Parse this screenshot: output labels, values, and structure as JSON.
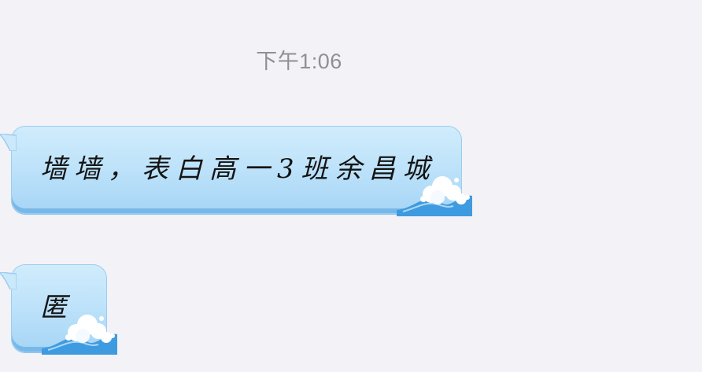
{
  "chat": {
    "timestamp": "下午1:06",
    "messages": [
      {
        "text": "墙墙，表白高一3班余昌城"
      },
      {
        "text": "匿"
      }
    ]
  },
  "colors": {
    "background": "#f2f2f7",
    "bubble_top": "#d0ecfc",
    "bubble_bottom": "#a6d5f6",
    "wave_blue": "#3f9be0",
    "timestamp": "#909093"
  },
  "icons": {
    "bubble_decoration": "wave-icon"
  }
}
